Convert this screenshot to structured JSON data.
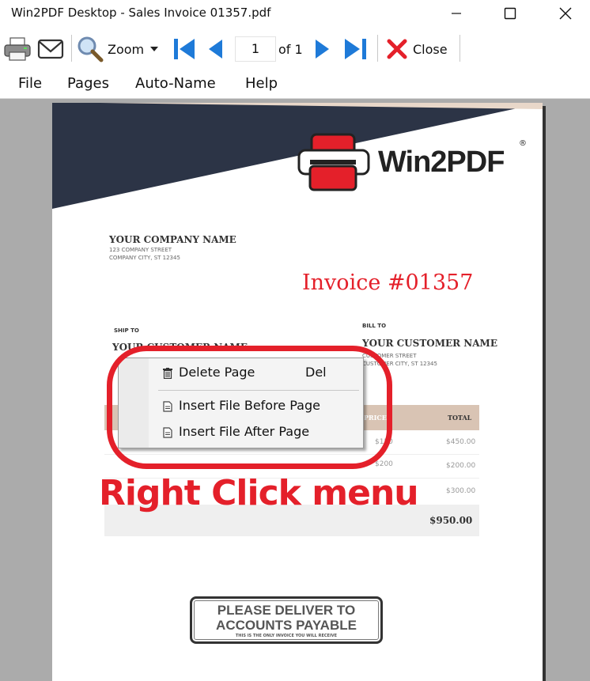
{
  "window": {
    "title": "Win2PDF Desktop - Sales Invoice 01357.pdf"
  },
  "toolbar": {
    "zoom_label": "Zoom",
    "page_number": "1",
    "page_of": "of 1",
    "close_label": "Close"
  },
  "menu": [
    "File",
    "Pages",
    "Auto-Name",
    "Help"
  ],
  "invoice": {
    "logo_text": "Win2PDF",
    "company_name": "YOUR COMPANY NAME",
    "company_street": "123 COMPANY STREET",
    "company_city": "COMPANY CITY, ST 12345",
    "invoice_title": "Invoice #01357",
    "ship_to_label": "SHIP TO",
    "ship_to_name": "YOUR CUSTOMER NAME",
    "bill_to_label": "BILL TO",
    "bill_to_name": "YOUR CUSTOMER NAME",
    "bill_to_street": "CUSTOMER STREET",
    "bill_to_city": "CUSTOMER CITY, ST 12345",
    "col_price": "PRICE",
    "col_total": "TOTAL",
    "line_prices": [
      "$150",
      "$200"
    ],
    "line_totals": [
      "$450.00",
      "$200.00",
      "$300.00"
    ],
    "grand_total": "$950.00",
    "stamp_line1": "PLEASE DELIVER TO",
    "stamp_line2": "ACCOUNTS PAYABLE",
    "stamp_small": "THIS IS THE ONLY INVOICE YOU WILL RECEIVE"
  },
  "context_menu": {
    "items": [
      {
        "label": "Delete Page",
        "shortcut": "Del",
        "icon": "trash-icon"
      },
      {
        "label": "Insert File Before Page",
        "icon": "document-icon"
      },
      {
        "label": "Insert File After Page",
        "icon": "document-icon"
      }
    ]
  },
  "annotation": {
    "callout": "Right Click menu"
  },
  "colors": {
    "accent_red": "#e4202a",
    "navy_band": "#2c3446",
    "table_header": "#d9c4b4",
    "arrow_blue": "#1e7ad8"
  }
}
